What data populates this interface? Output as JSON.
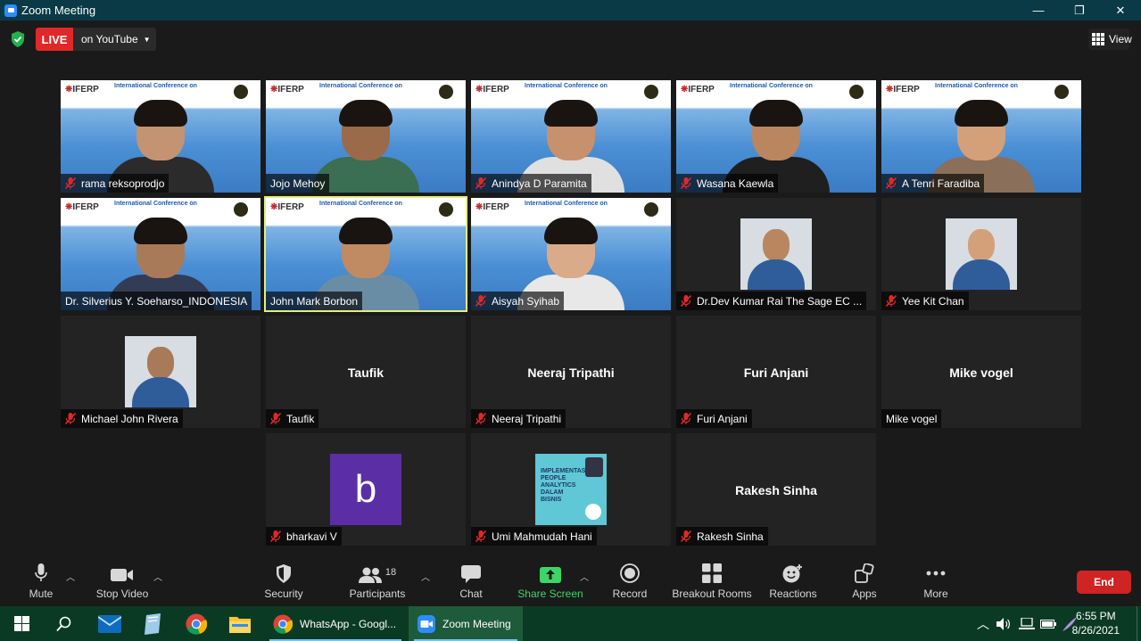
{
  "window": {
    "title": "Zoom Meeting",
    "minimize": "—",
    "maximize": "❐",
    "close": "✕"
  },
  "topbar": {
    "live_label": "LIVE",
    "stream_label": "on YouTube",
    "view_label": "View"
  },
  "participants": [
    {
      "name": "rama reksoprodjo",
      "muted": true,
      "kind": "video"
    },
    {
      "name": "Jojo Mehoy",
      "muted": false,
      "kind": "video"
    },
    {
      "name": "Anindya D Paramita",
      "muted": true,
      "kind": "video"
    },
    {
      "name": "Wasana Kaewla",
      "muted": true,
      "kind": "video"
    },
    {
      "name": "A Tenri Faradiba",
      "muted": true,
      "kind": "video"
    },
    {
      "name": "Dr. Silverius Y. Soeharso_INDONESIA",
      "muted": false,
      "kind": "video"
    },
    {
      "name": "John Mark Borbon",
      "muted": false,
      "kind": "video",
      "active_speaker": true
    },
    {
      "name": "Aisyah Syihab",
      "muted": true,
      "kind": "video"
    },
    {
      "name": "Dr.Dev Kumar Rai The Sage EC ...",
      "muted": true,
      "kind": "photo"
    },
    {
      "name": "Yee Kit Chan",
      "muted": true,
      "kind": "photo"
    },
    {
      "name": "Michael John Rivera",
      "muted": true,
      "kind": "photo"
    },
    {
      "name": "Taufik",
      "muted": true,
      "kind": "name",
      "display_name": "Taufik"
    },
    {
      "name": "Neeraj Tripathi",
      "muted": true,
      "kind": "name",
      "display_name": "Neeraj Tripathi"
    },
    {
      "name": "Furi Anjani",
      "muted": true,
      "kind": "name",
      "display_name": "Furi Anjani"
    },
    {
      "name": "Mike vogel",
      "muted": false,
      "kind": "name",
      "display_name": "Mike vogel"
    },
    {
      "name": "bharkavi V",
      "muted": true,
      "kind": "letter",
      "letter": "b",
      "color": "#5b2ea6"
    },
    {
      "name": "Umi Mahmudah Hani",
      "muted": true,
      "kind": "photo"
    },
    {
      "name": "Rakesh Sinha",
      "muted": true,
      "kind": "name",
      "display_name": "Rakesh Sinha"
    }
  ],
  "banner": {
    "title": "International Conference on",
    "logo": "IFERP"
  },
  "poster_text": "IMPLEMENTASI PEOPLE ANALYTICS DALAM BISNIS",
  "toolbar": {
    "mute": "Mute",
    "stop_video": "Stop Video",
    "security": "Security",
    "participants": "Participants",
    "participants_count": "18",
    "chat": "Chat",
    "share_screen": "Share Screen",
    "record": "Record",
    "breakout_rooms": "Breakout Rooms",
    "reactions": "Reactions",
    "apps": "Apps",
    "more": "More",
    "end": "End"
  },
  "taskbar": {
    "whatsapp_label": "WhatsApp - Googl...",
    "zoom_label": "Zoom Meeting",
    "time": "6:55 PM",
    "date": "8/26/2021"
  },
  "colors": {
    "accent_green": "#3cd666",
    "live_red": "#e02828",
    "end_red": "#d02323",
    "active_speaker": "#e3ee7f"
  }
}
